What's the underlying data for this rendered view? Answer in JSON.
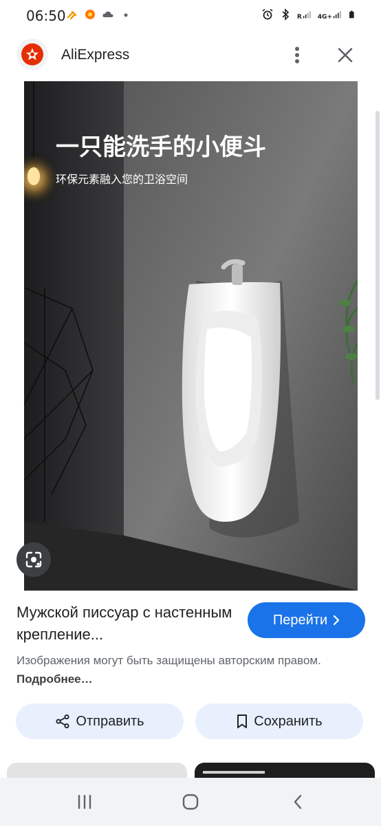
{
  "status": {
    "time": "06:50",
    "network_top": "4G+",
    "network_r": "R"
  },
  "header": {
    "app_title": "AliExpress"
  },
  "image": {
    "overlay_title": "一只能洗手的小便斗",
    "overlay_subtitle": "环保元素融入您的卫浴空间"
  },
  "product": {
    "title": "Мужской писсуар с настенным крепление...",
    "visit_label": "Перейти",
    "copyright_text": "Изображения могут быть защищены авторским правом.",
    "copyright_more": "Подробнее…"
  },
  "actions": {
    "share_label": "Отправить",
    "save_label": "Сохранить"
  },
  "icons": {
    "lens": "google-lens-icon",
    "kebab": "more-vert-icon",
    "close": "close-icon",
    "share": "share-icon",
    "bookmark": "bookmark-icon",
    "chevron": "chevron-right-icon"
  },
  "colors": {
    "brand": "#e62e04",
    "primary": "#1a73e8",
    "tonal_button": "#e8f0fe"
  }
}
